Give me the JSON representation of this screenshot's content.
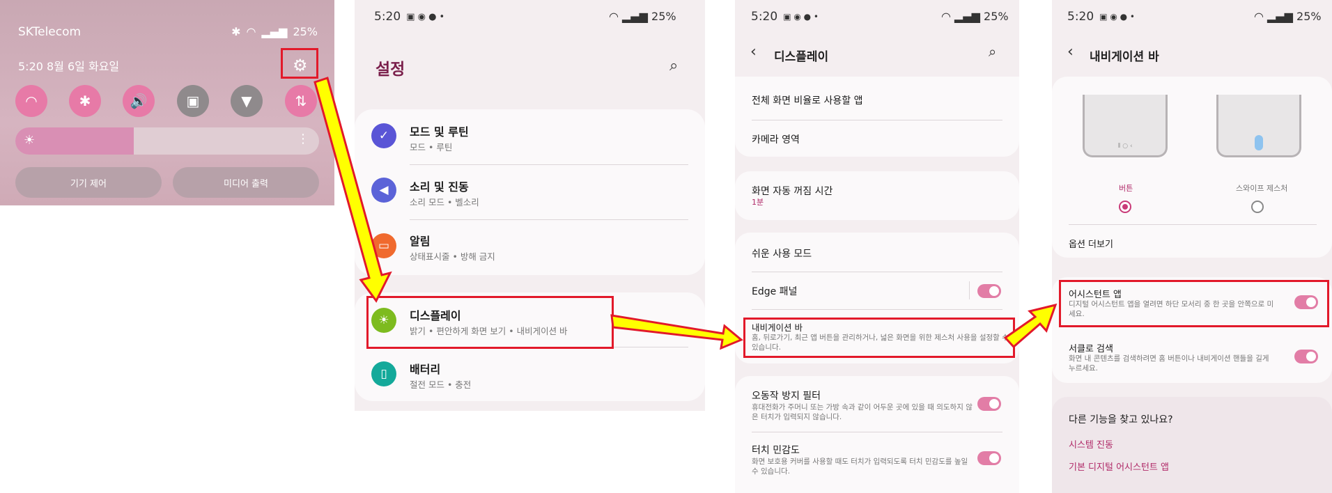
{
  "quick_panel": {
    "carrier": "SKTelecom",
    "battery": "25%",
    "datetime": "5:20  8월 6일 화요일",
    "tiles": [
      "wifi-icon",
      "bluetooth-icon",
      "volume-icon",
      "lock-icon",
      "flashlight-icon",
      "data-icon"
    ],
    "brightness": 0.39,
    "device_control": "기기 제어",
    "media_output": "미디어 출력"
  },
  "settings": {
    "time": "5:20",
    "battery": "25%",
    "title": "설정",
    "items": [
      {
        "title": "모드 및 루틴",
        "sub": "모드 • 루틴",
        "color": "#5a55d6"
      },
      {
        "title": "소리 및 진동",
        "sub": "소리 모드 • 벨소리",
        "color": "#5b63d8"
      },
      {
        "title": "알림",
        "sub": "상태표시줄 • 방해 금지",
        "color": "#f06a2e"
      },
      {
        "title": "디스플레이",
        "sub": "밝기 • 편안하게 화면 보기 • 내비게이션 바",
        "color": "#7dbb1f"
      },
      {
        "title": "배터리",
        "sub": "절전 모드 • 충전",
        "color": "#14a99a"
      }
    ]
  },
  "display": {
    "time": "5:20",
    "battery": "25%",
    "title": "디스플레이",
    "full_screen_apps": "전체 화면 비율로 사용할 앱",
    "camera_area": "카메라 영역",
    "screen_timeout": "화면 자동 꺼짐 시간",
    "screen_timeout_value": "1분",
    "easy_mode": "쉬운 사용 모드",
    "edge_panels": "Edge 패널",
    "nav_bar": "내비게이션 바",
    "nav_bar_desc": "홈, 뒤로가기, 최근 앱 버튼을 관리하거나, 넓은 화면을 위한 제스처 사용을 설정할 수 있습니다.",
    "accidental_touch": "오동작 방지 필터",
    "accidental_touch_desc": "휴대전화가 주머니 또는 가방 속과 같이 어두운 곳에 있을 때 의도하지 않은 터치가 입력되지 않습니다.",
    "touch_sensitivity": "터치 민감도",
    "touch_sensitivity_desc": "화면 보호용 커버를 사용할 때도 터치가 입력되도록 터치 민감도를 높일 수 있습니다."
  },
  "navbar": {
    "time": "5:20",
    "battery": "25%",
    "title": "내비게이션 바",
    "buttons_label": "버튼",
    "swipe_label": "스와이프 제스처",
    "more_options": "옵션 더보기",
    "assistant_app": "어시스턴트 앱",
    "assistant_desc": "디지털 어시스턴트 앱을 열려면 하단 모서리 중 한 곳을 안쪽으로 미세요.",
    "circle_search": "서클로 검색",
    "circle_search_desc": "화면 내 콘텐츠를 검색하려면 홈 버튼이나 내비게이션 핸들을 길게 누르세요.",
    "looking_for": "다른 기능을 찾고 있나요?",
    "link1": "시스템 진동",
    "link2": "기본 디지털 어시스턴트 앱"
  },
  "colors": {
    "accent": "#b02a68",
    "highlight": "#e2192a",
    "arrow_fill": "#ffff00"
  }
}
